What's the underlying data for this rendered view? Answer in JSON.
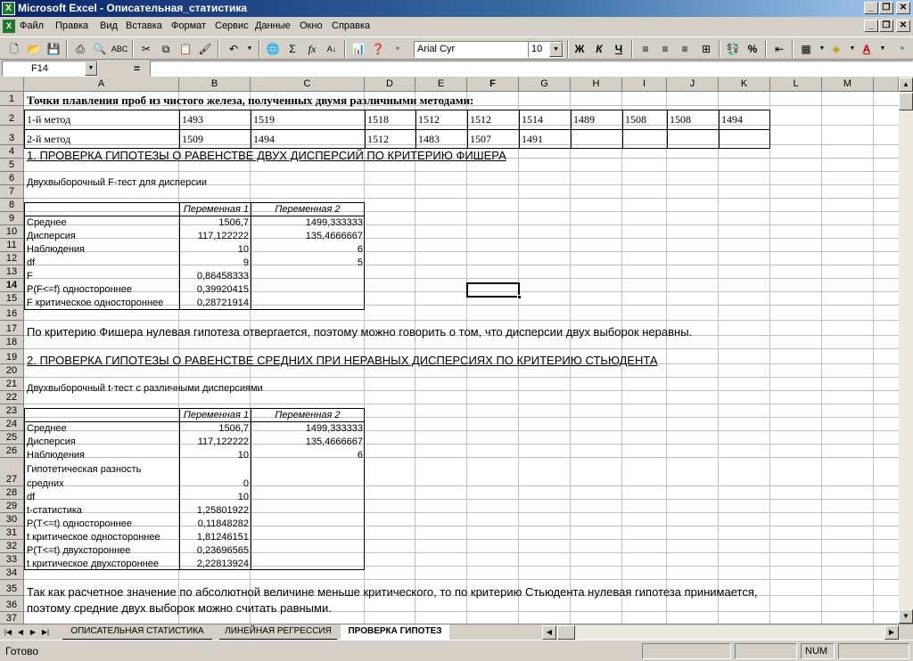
{
  "window": {
    "title": "Microsoft Excel - Описательная_статистика"
  },
  "menu": [
    "Файл",
    "Правка",
    "Вид",
    "Вставка",
    "Формат",
    "Сервис",
    "Данные",
    "Окно",
    "Справка"
  ],
  "toolbar": {
    "font_name": "Arial Cyr",
    "font_size": "10",
    "bold": "Ж",
    "italic": "К",
    "underline": "Ч",
    "percent": "%",
    "sum": "Σ",
    "fx": "fx"
  },
  "formula_bar": {
    "cell_ref": "F14",
    "equals": "=",
    "content": ""
  },
  "columns": [
    "A",
    "B",
    "C",
    "D",
    "E",
    "F",
    "G",
    "H",
    "I",
    "J",
    "K",
    "L",
    "M"
  ],
  "rows": [
    "1",
    "2",
    "3",
    "4",
    "5",
    "6",
    "7",
    "8",
    "9",
    "10",
    "11",
    "12",
    "13",
    "14",
    "15",
    "16",
    "17",
    "18",
    "19",
    "20",
    "21",
    "22",
    "23",
    "24",
    "25",
    "26",
    "27",
    "28",
    "29",
    "30",
    "31",
    "32",
    "33",
    "34",
    "35",
    "36",
    "37"
  ],
  "cells": {
    "A1": "Точки плавления    проб из чистого железа, полученных двумя различными методами:",
    "A2": "1-й метод",
    "B2": "1493",
    "C2": "1519",
    "D2": "1518",
    "E2": "1512",
    "F2": "1512",
    "G2": "1514",
    "H2": "1489",
    "I2": "1508",
    "J2": "1508",
    "K2": "1494",
    "A3": "2-й метод",
    "B3": "1509",
    "C3": "1494",
    "D3": "1512",
    "E3": "1483",
    "F3": "1507",
    "G3": "1491",
    "A4": "1. ПРОВЕРКА ГИПОТЕЗЫ О РАВЕНСТВЕ ДВУХ ДИСПЕРСИЙ ПО КРИТЕРИЮ ФИШЕРА",
    "A6": "Двухвыборочный F-тест для дисперсии",
    "B8": "Переменная 1",
    "C8": "Переменная 2",
    "A9": "Среднее",
    "B9": "1506,7",
    "C9": "1499,333333",
    "A10": "Дисперсия",
    "B10": "117,122222",
    "C10": "135,4666667",
    "A11": "Наблюдения",
    "B11": "10",
    "C11": "6",
    "A12": "df",
    "B12": "9",
    "C12": "5",
    "A13": "F",
    "B13": "0,86458333",
    "A14": "P(F<=f) одностороннее",
    "B14": "0,39920415",
    "A15": "F критическое одностороннее",
    "B15": "0,28721914",
    "A17": "По критерию Фишера нулевая гипотеза отвергается, поэтому можно говорить о том, что дисперсии двух выборок неравны.",
    "A19": "2. ПРОВЕРКА ГИПОТЕЗЫ О РАВЕНСТВЕ СРЕДНИХ ПРИ НЕРАВНЫХ ДИСПЕРСИЯХ ПО КРИТЕРИЮ СТЬЮДЕНТА",
    "A21": "Двухвыборочный t-тест с различными дисперсиями",
    "B23": "Переменная 1",
    "C23": "Переменная 2",
    "A24": "Среднее",
    "B24": "1506,7",
    "C24": "1499,333333",
    "A25": "Дисперсия",
    "B25": "117,122222",
    "C25": "135,4666667",
    "A26": "Наблюдения",
    "B26": "10",
    "C26": "6",
    "A27a": "Гипотетическая разность",
    "A27b": "средних",
    "B27": "0",
    "A28": "df",
    "B28": "10",
    "A29": "t-статистика",
    "B29": "1,25801922",
    "A30": "P(T<=t) одностороннее",
    "B30": "0,11848282",
    "A31": "t критическое одностороннее",
    "B31": "1,81246151",
    "A32": "P(T<=t) двухстороннее",
    "B32": "0,23696565",
    "A33": "t критическое двухстороннее",
    "B33": "2,22813924",
    "A35": "Так как расчетное значение по абсолютной величине меньше критического, то по критерию Стьюдента нулевая гипотеза принимается,",
    "A36": "поэтому средние двух выборок можно считать равными."
  },
  "sheet_tabs": [
    "ОПИСАТЕЛЬНАЯ СТАТИСТИКА",
    "ЛИНЕЙНАЯ РЕГРЕССИЯ",
    "ПРОВЕРКА ГИПОТЕЗ"
  ],
  "active_tab": "ПРОВЕРКА ГИПОТЕЗ",
  "status": {
    "text": "Готово",
    "num": "NUM"
  },
  "colors": {
    "title_bar": "#0a246a",
    "chrome": "#d4d0c8",
    "grid": "#c0c0c0",
    "excel_icon": "#1d7a2c"
  }
}
